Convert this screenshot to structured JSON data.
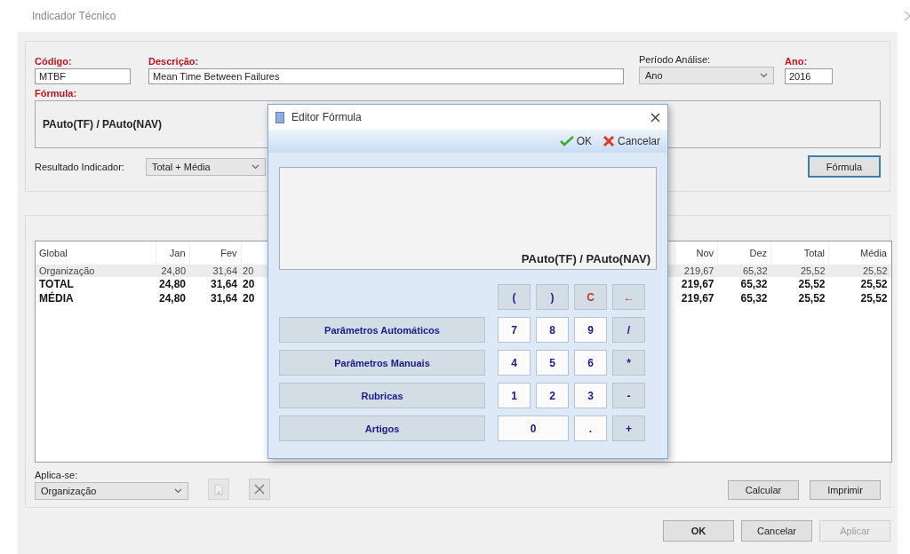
{
  "window": {
    "title": "Indicador Técnico"
  },
  "fields": [
    {
      "label": "Código:",
      "required": true,
      "value": "MTBF"
    },
    {
      "label": "Descrição:",
      "required": true,
      "value": "Mean Time Between Failures"
    },
    {
      "label": "Período Análise:",
      "required": false,
      "value": "Ano",
      "kind": "combo"
    },
    {
      "label": "Ano:",
      "required": true,
      "value": "2016"
    }
  ],
  "formula": {
    "label": "Fórmula:",
    "required": true,
    "value": "PAuto(TF) / PAuto(NAV)"
  },
  "result": {
    "label": "Resultado Indicador:",
    "value": "Total + Média"
  },
  "formula_button": "Fórmula",
  "table": {
    "columns": [
      "Global",
      "Jan",
      "Fev",
      "",
      "Nov",
      "Dez",
      "Total",
      "Média"
    ],
    "rows": [
      {
        "kind": "detail",
        "cells": [
          "Organização",
          "24,80",
          "31,64",
          "20",
          "219,67",
          "65,32",
          "25,52",
          "25,52"
        ]
      },
      {
        "kind": "summary",
        "cells": [
          "TOTAL",
          "24,80",
          "31,64",
          "20",
          "219,67",
          "65,32",
          "25,52",
          "25,52"
        ]
      },
      {
        "kind": "summary",
        "cells": [
          "MÉDIA",
          "24,80",
          "31,64",
          "20",
          "219,67",
          "65,32",
          "25,52",
          "25,52"
        ]
      }
    ]
  },
  "applies": {
    "label": "Aplica-se:",
    "value": "Organização"
  },
  "action_buttons": [
    {
      "label": "Calcular",
      "disabled": false
    },
    {
      "label": "Imprimir",
      "disabled": false
    }
  ],
  "footer_buttons": [
    {
      "label": "OK",
      "disabled": false,
      "bold": true
    },
    {
      "label": "Cancelar",
      "disabled": false,
      "bold": false
    },
    {
      "label": "Aplicar",
      "disabled": true,
      "bold": false
    }
  ],
  "dialog": {
    "title": "Editor Fórmula",
    "ok": "OK",
    "cancel": "Cancelar",
    "display": "PAuto(TF) / PAuto(NAV)",
    "parameter_buttons": [
      "Parâmetros Automáticos",
      "Parâmetros Manuais",
      "Rubricas",
      "Artigos"
    ],
    "keys": [
      {
        "label": "(",
        "kind": "operator"
      },
      {
        "label": ")",
        "kind": "operator"
      },
      {
        "label": "C",
        "kind": "clear"
      },
      {
        "label": "←",
        "kind": "clear"
      },
      {
        "label": "7",
        "kind": "digit"
      },
      {
        "label": "8",
        "kind": "digit"
      },
      {
        "label": "9",
        "kind": "digit"
      },
      {
        "label": "/",
        "kind": "operator"
      },
      {
        "label": "4",
        "kind": "digit"
      },
      {
        "label": "5",
        "kind": "digit"
      },
      {
        "label": "6",
        "kind": "digit"
      },
      {
        "label": "*",
        "kind": "operator"
      },
      {
        "label": "1",
        "kind": "digit"
      },
      {
        "label": "2",
        "kind": "digit"
      },
      {
        "label": "3",
        "kind": "digit"
      },
      {
        "label": "-",
        "kind": "operator"
      },
      {
        "label": "0",
        "kind": "wide"
      },
      {
        "label": ".",
        "kind": "digit"
      },
      {
        "label": "+",
        "kind": "operator"
      }
    ]
  }
}
